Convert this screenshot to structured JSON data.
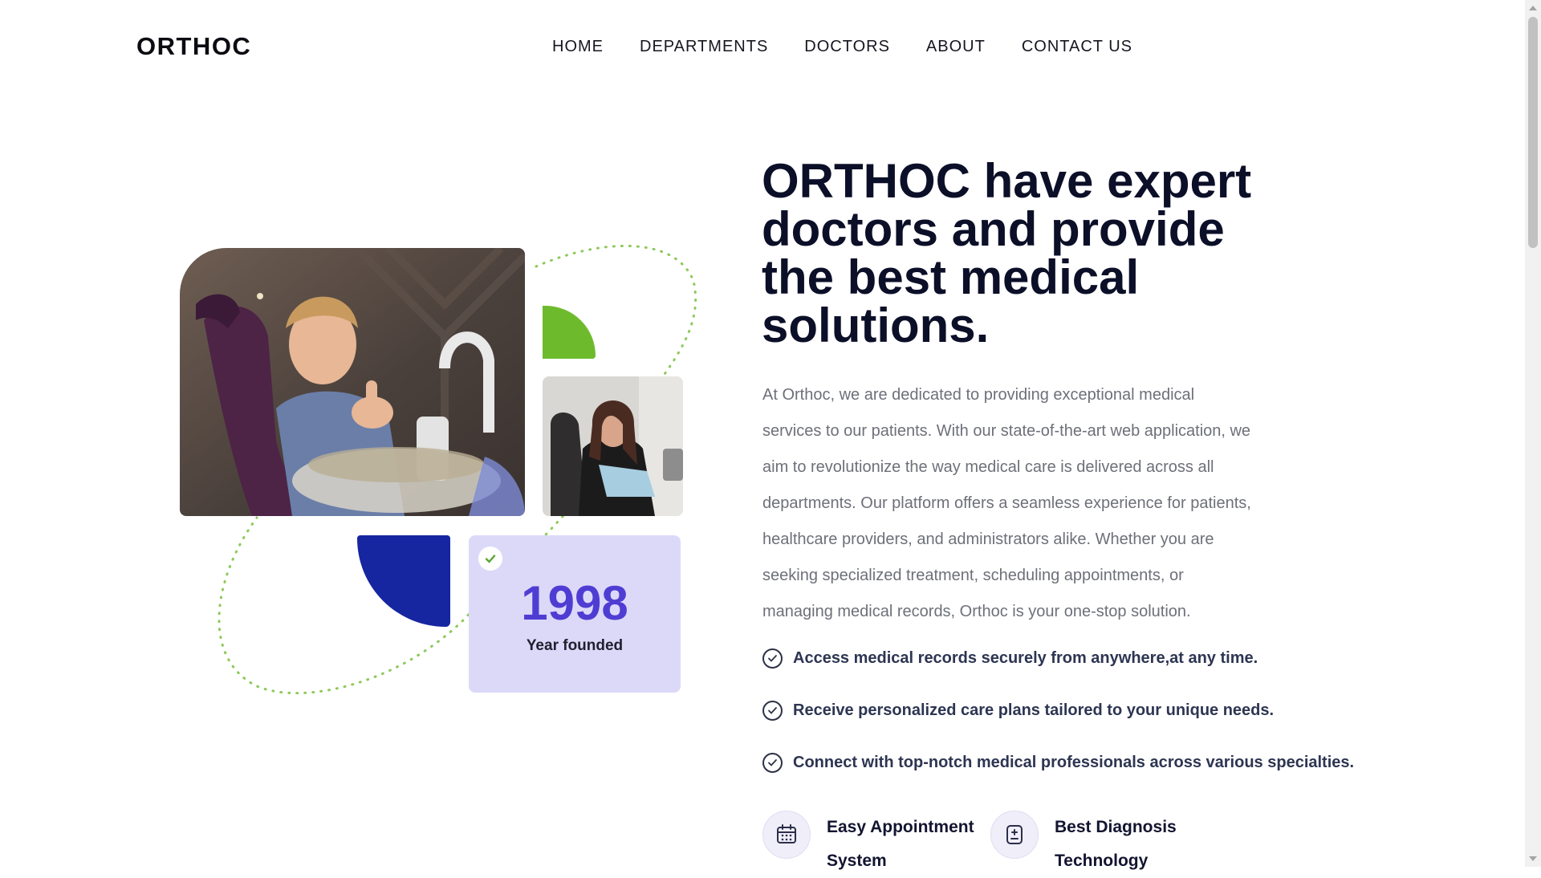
{
  "header": {
    "logo": "ORTHOC",
    "nav": [
      "HOME",
      "DEPARTMENTS",
      "DOCTORS",
      "ABOUT",
      "CONTACT US"
    ]
  },
  "hero": {
    "title": "ORTHOC have expert doctors and provide the best medical solutions.",
    "description": "At Orthoc, we are dedicated to providing exceptional medical services to our patients. With our state-of-the-art web application, we aim to revolutionize the way medical care is delivered across all departments. Our platform offers a seamless experience for patients, healthcare providers, and administrators alike. Whether you are seeking specialized treatment, scheduling appointments, or managing medical records, Orthoc is your one-stop solution.",
    "features": [
      "Access medical records securely from anywhere,at any time.",
      "Receive personalized care plans tailored to your unique needs.",
      "Connect with top-notch medical professionals across various specialties."
    ],
    "services": [
      {
        "label": "Easy Appointment System",
        "icon": "calendar-icon"
      },
      {
        "label": "Best Diagnosis Technology",
        "icon": "diagnosis-icon"
      }
    ]
  },
  "stat": {
    "year": "1998",
    "caption": "Year founded",
    "badge_icon": "check-icon"
  },
  "images": {
    "main": "boy-in-dental-chair-thumbs-up",
    "secondary": "woman-smiling-in-dental-chair"
  },
  "colors": {
    "green_accent": "#6dbb2d",
    "blue_accent": "#1626a0",
    "stat_bg": "#dcd9f8",
    "stat_number": "#4f3dd3"
  }
}
